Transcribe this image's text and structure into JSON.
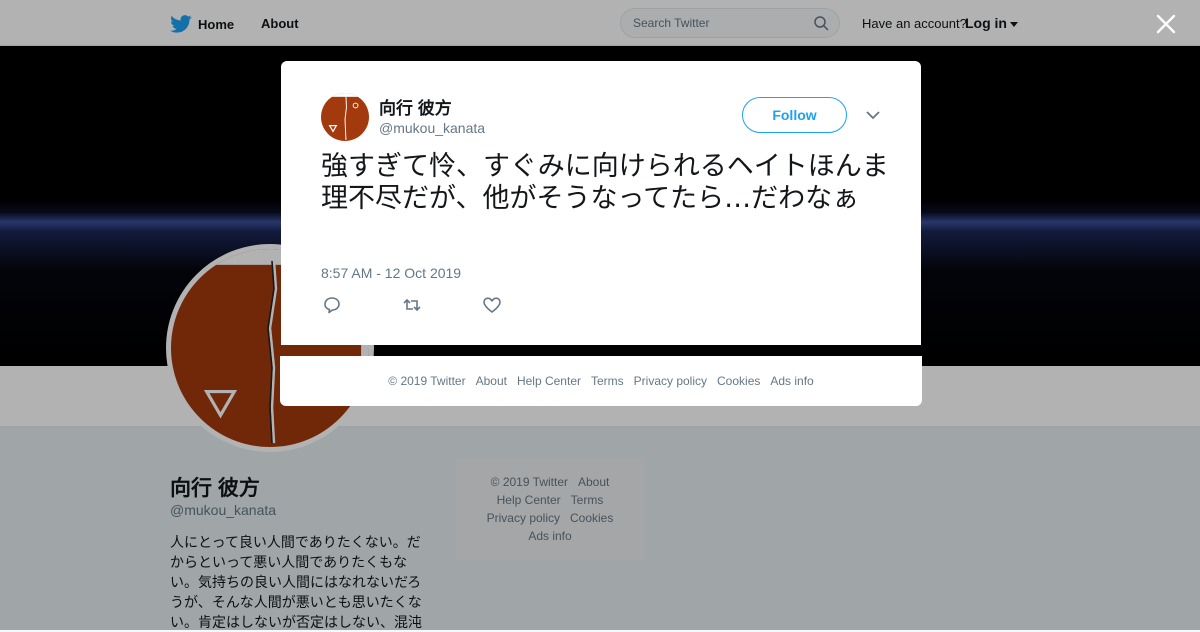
{
  "nav": {
    "home_label": "Home",
    "about_label": "About",
    "search_placeholder": "Search Twitter",
    "have_account": "Have an account?",
    "login_label": "Log in"
  },
  "profile": {
    "name": "向行 彼方",
    "handle": "@mukou_kanata",
    "bio": "人にとって良い人間でありたくない。だからといって悪い人間でありたくもない。気持ちの良い人間にはなれないだろうが、そんな人間が悪いとも思いたくない。肯定はしないが否定はしない、混沌"
  },
  "side_footer": {
    "row1": [
      "© 2019 Twitter",
      "About"
    ],
    "row2": [
      "Help Center",
      "Terms"
    ],
    "row3": [
      "Privacy policy",
      "Cookies"
    ],
    "row4": [
      "Ads info"
    ]
  },
  "tweet": {
    "name": "向行 彼方",
    "handle": "@mukou_kanata",
    "follow_label": "Follow",
    "text": "強すぎて怜、すぐみに向けられるヘイトほんま理不尽だが、他がそうなってたら…だわなぁ",
    "timestamp": "8:57 AM - 12 Oct 2019"
  },
  "modal_footer": [
    "© 2019 Twitter",
    "About",
    "Help Center",
    "Terms",
    "Privacy policy",
    "Cookies",
    "Ads info"
  ],
  "colors": {
    "accent": "#1da1f2",
    "avatar_bg": "#a33a0e",
    "secondary_text": "#657786"
  }
}
